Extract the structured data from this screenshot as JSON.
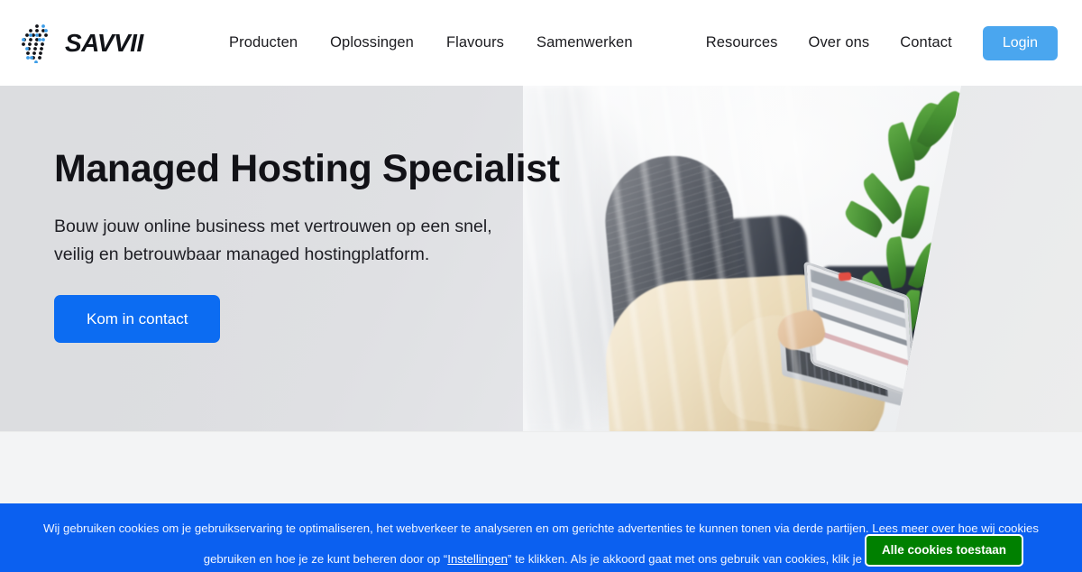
{
  "header": {
    "logo": {
      "name": "savvii-logo",
      "wordmark": "SAVVII",
      "dot_colors": [
        "#111318",
        "#3d9de8"
      ]
    },
    "nav_left": [
      {
        "label": "Producten"
      },
      {
        "label": "Oplossingen"
      },
      {
        "label": "Flavours"
      },
      {
        "label": "Samenwerken"
      }
    ],
    "nav_right": [
      {
        "label": "Resources"
      },
      {
        "label": "Over ons"
      },
      {
        "label": "Contact"
      }
    ],
    "login_label": "Login",
    "login_color": "#4aa6ef"
  },
  "hero": {
    "title": "Managed Hosting Specialist",
    "subtitle_line1": "Bouw jouw online business met vertrouwen op een snel,",
    "subtitle_line2": "veilig en betrouwbaar managed hostingplatform.",
    "cta_label": "Kom in contact",
    "cta_color": "#0c6cf2",
    "background_color": "#dcdde0",
    "image_alt": "Vrouw met lang donker haar achter een laptop op kantoor, met plant op de achtergrond"
  },
  "cookie_banner": {
    "background_color": "#0b60f0",
    "text_part1": "Wij gebruiken cookies om je gebruikservaring te optimaliseren, het webverkeer te analyseren en om gerichte advertenties te kunnen tonen via derde partijen. Lees meer over hoe wij cookies gebruiken en hoe je ze kunt beheren door op “",
    "settings_link": "Instellingen",
    "text_part2": "” te klikken. Als je akkoord gaat met ons gebruik van cookies, klik je op",
    "accept_label": "Alle cookies toestaan",
    "accept_color": "#008000"
  }
}
